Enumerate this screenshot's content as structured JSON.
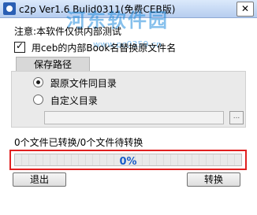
{
  "window": {
    "title": "c2p   Ver1.6 Bulid0311(免费CEB版)",
    "close_symbol": "✕"
  },
  "watermark": {
    "text": "河东软件园",
    "url": "www.pc0359.cn"
  },
  "notice": "注意:本软件仅供内部测试",
  "options": {
    "rename_checkbox": {
      "label": "用ceb的内部Book名替换原文件名",
      "checked": true
    }
  },
  "save_path": {
    "group_label": "保存路径",
    "radios": [
      {
        "label": "跟原文件同目录",
        "selected": true
      },
      {
        "label": "自定义目录",
        "selected": false
      }
    ],
    "custom_path_value": "",
    "browse_label": "..."
  },
  "status": {
    "text": "0个文件已转换/0个文件待转换"
  },
  "progress": {
    "value": 0,
    "label": "0%"
  },
  "buttons": {
    "exit_label": "退出",
    "convert_label": "转换"
  },
  "colors": {
    "progress_border": "#e02020",
    "progress_text": "#1a5cc8",
    "watermark": "#238cdc"
  }
}
